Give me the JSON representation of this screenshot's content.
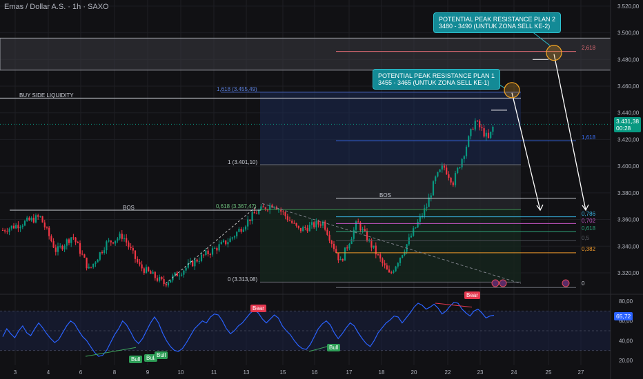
{
  "header": {
    "title": "Emas / Dollar A.S. · 1h · SAXO"
  },
  "price_badge": {
    "price": "3.431,38",
    "time": "00:28",
    "color": "#089981"
  },
  "rsi_badge": {
    "value": "65,72",
    "color": "#2a62ff"
  },
  "annotations": {
    "plan2": {
      "line1": "POTENTIAL PEAK RESISTANCE PLAN 2",
      "line2": "3480 - 3490 (UNTUK ZONA SELL KE-2)"
    },
    "plan1": {
      "line1": "POTENTIAL PEAK RESISTANCE PLAN 1",
      "line2": "3455 - 3465 (UNTUK ZONA SELL KE-1)"
    },
    "buy_side_liquidity": "BUY SIDE LIQUIDITY",
    "bos_left": "BOS",
    "bos_right": "BOS"
  },
  "fib_left": {
    "level_1618": "1,618 (3.455,49)",
    "level_1": "1 (3.401,10)",
    "level_0618": "0,618 (3.367,47)",
    "level_0": "0 (3.313,08)"
  },
  "fib_right": {
    "level_2618": "2,618",
    "level_1618": "1,618",
    "level_0786": "0,786",
    "level_0702": "0,702",
    "level_0618": "0,618",
    "level_05": "0,5",
    "level_0382": "0,382",
    "level_0": "0"
  },
  "signals": {
    "bear1": "Bear",
    "bear2": "Bear",
    "bull1": "Bull",
    "bull2": "Bull",
    "bull3": "Bull",
    "bull4": "Bull"
  },
  "colors": {
    "up": "#089981",
    "down": "#f23645",
    "rsi": "#2a62ff",
    "bg": "#111114",
    "grid": "#1e1f24",
    "note": "#138a96"
  },
  "chart_data": [
    {
      "type": "candlestick",
      "title": "Emas / Dollar A.S. · 1h · SAXO",
      "x_tick_labels": [
        "3",
        "4",
        "6",
        "8",
        "9",
        "10",
        "11",
        "13",
        "15",
        "16",
        "17",
        "18",
        "20",
        "22",
        "23",
        "24",
        "25",
        "27"
      ],
      "y_tick_labels": [
        "3.520,00",
        "3.500,00",
        "3.480,00",
        "3.460,00",
        "3.440,00",
        "3.420,00",
        "3.400,00",
        "3.380,00",
        "3.360,00",
        "3.340,00",
        "3.320,00"
      ],
      "ylim": [
        3305,
        3522
      ],
      "grid": false,
      "series": [
        {
          "key_points": [
            {
              "x": "3",
              "y": 3352
            },
            {
              "x": "3",
              "y": 3362
            },
            {
              "x": "4",
              "y": 3336
            },
            {
              "x": "4",
              "y": 3348
            },
            {
              "x": "6",
              "y": 3322
            },
            {
              "x": "6",
              "y": 3342
            },
            {
              "x": "8",
              "y": 3348
            },
            {
              "x": "8",
              "y": 3325
            },
            {
              "x": "9",
              "y": 3312
            },
            {
              "x": "10",
              "y": 3330
            },
            {
              "x": "11",
              "y": 3345
            },
            {
              "x": "13",
              "y": 3365
            },
            {
              "x": "13",
              "y": 3372
            },
            {
              "x": "15",
              "y": 3352
            },
            {
              "x": "16",
              "y": 3358
            },
            {
              "x": "16",
              "y": 3328
            },
            {
              "x": "17",
              "y": 3358
            },
            {
              "x": "17",
              "y": 3338
            },
            {
              "x": "18",
              "y": 3318
            },
            {
              "x": "18",
              "y": 3340
            },
            {
              "x": "20",
              "y": 3358
            },
            {
              "x": "20",
              "y": 3370
            },
            {
              "x": "20",
              "y": 3390
            },
            {
              "x": "20",
              "y": 3400
            },
            {
              "x": "22",
              "y": 3388
            },
            {
              "x": "22",
              "y": 3410
            },
            {
              "x": "22",
              "y": 3434
            },
            {
              "x": "23",
              "y": 3420
            },
            {
              "x": "23",
              "y": 3431.38
            }
          ]
        }
      ],
      "projections": [
        {
          "from": {
            "x": "23",
            "y": 3455
          },
          "to": {
            "x": "24",
            "y": 3367
          }
        },
        {
          "from": {
            "x": "24",
            "y": 3484
          },
          "to": {
            "x": "27",
            "y": 3367
          }
        }
      ]
    },
    {
      "type": "line",
      "title": "RSI",
      "y_tick_labels": [
        "80,00",
        "60,00",
        "40,00",
        "20,00"
      ],
      "ylim": [
        15,
        85
      ],
      "last_value": 65.72,
      "series": [
        {
          "values": [
            44,
            52,
            47,
            43,
            50,
            55,
            48,
            45,
            52,
            58,
            53,
            47,
            42,
            38,
            41,
            48,
            55,
            60,
            57,
            50,
            44,
            40,
            34,
            28,
            24,
            25,
            30,
            38,
            46,
            52,
            60,
            56,
            49,
            41,
            37,
            42,
            50,
            58,
            64,
            58,
            48,
            40,
            34,
            30,
            29,
            32,
            38,
            45,
            52,
            56,
            60,
            58,
            64,
            67,
            66,
            60,
            52,
            47,
            50,
            55,
            58,
            63,
            68,
            71,
            68,
            62,
            58,
            62,
            66,
            63,
            55,
            50,
            46,
            40,
            35,
            32,
            31,
            36,
            44,
            52,
            57,
            60,
            56,
            48,
            42,
            47,
            53,
            58,
            55,
            48,
            42,
            37,
            34,
            40,
            48,
            53,
            58,
            61,
            65,
            64,
            58,
            63,
            68,
            74,
            78,
            76,
            72,
            74,
            77,
            73,
            67,
            70,
            75,
            79,
            78,
            72,
            68,
            65,
            70,
            72,
            68,
            63,
            65,
            65.72
          ]
        }
      ]
    }
  ]
}
